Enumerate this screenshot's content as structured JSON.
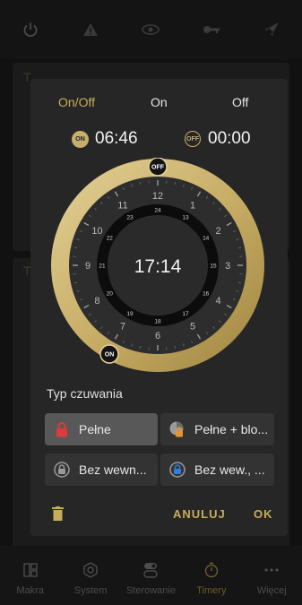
{
  "colors": {
    "accent": "#c9ad58",
    "gold": "#c5ae6e",
    "dialog": "#262626",
    "danger": "#e03a3a",
    "lock_orange": "#e5962e",
    "lock_blue": "#2f7ee0"
  },
  "top_icons": [
    "power-icon",
    "warning-icon",
    "eye-icon",
    "key-icon",
    "rocket-icon"
  ],
  "dialog": {
    "modes": {
      "on_off": "On/Off",
      "on": "On",
      "off": "Off",
      "selected": "On/Off"
    },
    "on_badge": "ON",
    "on_time": "06:46",
    "off_badge": "OFF",
    "off_time": "00:00",
    "clock": {
      "center_time": "17:14",
      "outer_hours": [
        "12",
        "1",
        "2",
        "3",
        "4",
        "5",
        "6",
        "7",
        "8",
        "9",
        "10",
        "11"
      ],
      "inner_hours": [
        "24",
        "13",
        "14",
        "15",
        "16",
        "17",
        "18",
        "19",
        "20",
        "21",
        "22",
        "23"
      ],
      "on_marker": "ON",
      "off_marker": "OFF"
    },
    "arming_type_label": "Typ czuwania",
    "options": [
      {
        "label": "Pełne",
        "icon": "lock-red-icon",
        "selected": true
      },
      {
        "label": "Pełne + blo...",
        "icon": "lock-orange-icon",
        "selected": false
      },
      {
        "label": "Bez wewn...",
        "icon": "lock-grey-icon",
        "selected": false
      },
      {
        "label": "Bez wew., ...",
        "icon": "lock-blue-icon",
        "selected": false
      }
    ],
    "delete_icon": "trash-icon",
    "cancel": "ANULUJ",
    "ok": "OK"
  },
  "bottom_nav": [
    {
      "label": "Makra",
      "icon": "macros-icon",
      "active": false
    },
    {
      "label": "System",
      "icon": "system-icon",
      "active": false
    },
    {
      "label": "Sterowanie",
      "icon": "control-icon",
      "active": false
    },
    {
      "label": "Timery",
      "icon": "timer-icon",
      "active": true
    },
    {
      "label": "Więcej",
      "icon": "more-icon",
      "active": false
    }
  ]
}
